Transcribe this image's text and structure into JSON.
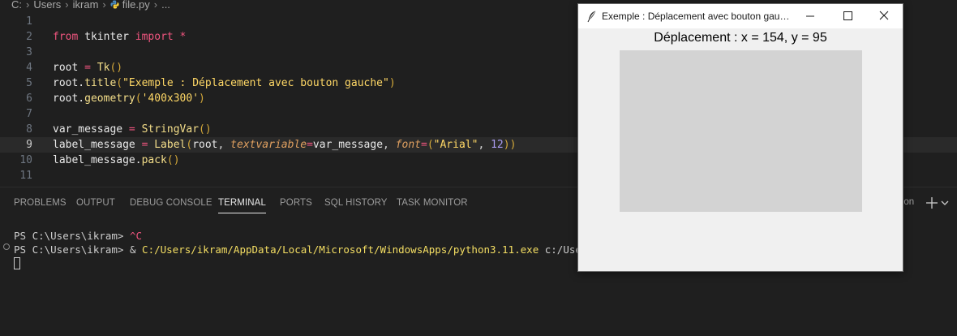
{
  "breadcrumb": {
    "items": [
      "C:",
      "Users",
      "ikram",
      "file.py",
      "..."
    ],
    "file_icon": "python-file-icon"
  },
  "editor": {
    "lines": [
      {
        "n": "1",
        "tokens": []
      },
      {
        "n": "2",
        "tokens": [
          [
            "t-kw",
            "from"
          ],
          [
            "t-id",
            " tkinter "
          ],
          [
            "t-kw",
            "import"
          ],
          [
            "t-op",
            " *"
          ]
        ]
      },
      {
        "n": "3",
        "tokens": []
      },
      {
        "n": "4",
        "tokens": [
          [
            "t-id",
            "root "
          ],
          [
            "t-op",
            "="
          ],
          [
            "t-cls",
            " Tk"
          ],
          [
            "t-paren",
            "()"
          ]
        ]
      },
      {
        "n": "5",
        "tokens": [
          [
            "t-id",
            "root."
          ],
          [
            "t-fn",
            "title"
          ],
          [
            "t-paren",
            "("
          ],
          [
            "t-str",
            "\"Exemple : Déplacement avec bouton gauche\""
          ],
          [
            "t-paren",
            ")"
          ]
        ]
      },
      {
        "n": "6",
        "tokens": [
          [
            "t-id",
            "root."
          ],
          [
            "t-fn",
            "geometry"
          ],
          [
            "t-paren",
            "("
          ],
          [
            "t-str",
            "'400x300'"
          ],
          [
            "t-paren",
            ")"
          ]
        ]
      },
      {
        "n": "7",
        "tokens": []
      },
      {
        "n": "8",
        "tokens": [
          [
            "t-id",
            "var_message "
          ],
          [
            "t-op",
            "="
          ],
          [
            "t-cls",
            " StringVar"
          ],
          [
            "t-paren",
            "()"
          ]
        ]
      },
      {
        "n": "9",
        "tokens": [
          [
            "t-id",
            "label_message "
          ],
          [
            "t-op",
            "="
          ],
          [
            "t-cls",
            " Label"
          ],
          [
            "t-paren",
            "("
          ],
          [
            "t-id",
            "root"
          ],
          [
            "t-comma",
            ", "
          ],
          [
            "t-param",
            "textvariable"
          ],
          [
            "t-op",
            "="
          ],
          [
            "t-id",
            "var_message"
          ],
          [
            "t-comma",
            ", "
          ],
          [
            "t-param",
            "font"
          ],
          [
            "t-op",
            "="
          ],
          [
            "t-paren",
            "("
          ],
          [
            "t-str",
            "\"Arial\""
          ],
          [
            "t-comma",
            ", "
          ],
          [
            "t-num",
            "12"
          ],
          [
            "t-paren",
            "))"
          ]
        ]
      },
      {
        "n": "10",
        "tokens": [
          [
            "t-id",
            "label_message."
          ],
          [
            "t-fn",
            "pack"
          ],
          [
            "t-paren",
            "()"
          ]
        ]
      },
      {
        "n": "11",
        "tokens": []
      }
    ],
    "current_line": "9"
  },
  "panel": {
    "tabs": [
      "PROBLEMS",
      "OUTPUT",
      "DEBUG CONSOLE",
      "TERMINAL",
      "PORTS",
      "SQL HISTORY",
      "TASK MONITOR"
    ],
    "active_tab": "TERMINAL",
    "right_label": "hon"
  },
  "terminal": {
    "line1_prompt": "PS C:\\Users\\ikram> ",
    "line1_cmd": "^C",
    "line2_prompt": "PS C:\\Users\\ikram> & ",
    "line2_path": "C:/Users/ikram/AppData/Local/Microsoft/WindowsApps/python3.11.exe",
    "line2_arg": " c:/Users/ikra"
  },
  "tk_window": {
    "title": "Exemple : Déplacement avec bouton gauche",
    "label": "Déplacement : x = 154, y = 95",
    "canvas_color": "#d3d3d3"
  },
  "colors": {
    "editor_bg": "#1f1f1f",
    "keyword": "#f0557f",
    "string": "#ffd866"
  }
}
